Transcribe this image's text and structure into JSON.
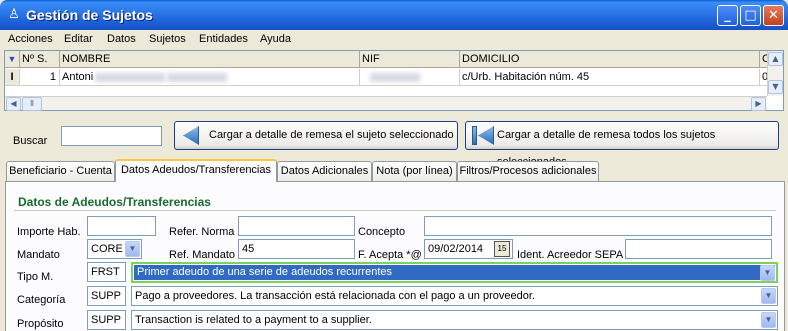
{
  "window": {
    "title": "Gestión de Sujetos",
    "minimize": "_",
    "maximize": "□",
    "close": "✕"
  },
  "menu": [
    "Acciones",
    "Editar",
    "Datos",
    "Sujetos",
    "Entidades",
    "Ayuda"
  ],
  "grid": {
    "columns": [
      "Nº S.",
      "NOMBRE",
      "NIF",
      "DOMICILIO",
      "C"
    ],
    "rows": [
      {
        "num": "1",
        "nombre": "Antoni",
        "nif": "",
        "domicilio": "c/Urb. Habitación núm. 45",
        "c": "0"
      }
    ]
  },
  "search": {
    "label": "Buscar",
    "value": ""
  },
  "actions": {
    "load_selected": "Cargar a detalle de remesa el sujeto seleccionado",
    "load_all": "Cargar a detalle de remesa todos los sujetos seleccionados"
  },
  "tabs": [
    "Beneficiario - Cuenta",
    "Datos Adeudos/Transferencias",
    "Datos Adicionales",
    "Nota (por línea)",
    "Filtros/Procesos adicionales"
  ],
  "active_tab": "Datos Adeudos/Transferencias",
  "section_title": "Datos de Adeudos/Transferencias",
  "form": {
    "importe_hab_label": "Importe Hab.",
    "importe_hab": "",
    "refer_norma_label": "Refer. Norma",
    "refer_norma": "",
    "concepto_label": "Concepto",
    "concepto": "",
    "mandato_label": "Mandato",
    "mandato": "CORE",
    "ref_mandato_label": "Ref. Mandato",
    "ref_mandato": "45",
    "f_acepta_label": "F. Acepta *@",
    "f_acepta": "09/02/2014",
    "ident_acreedor_label": "Ident. Acreedor SEPA",
    "ident_acreedor": "",
    "tipo_m_label": "Tipo M.",
    "tipo_m_code": "FRST",
    "tipo_m_desc": "Primer adeudo de una serie de adeudos recurrentes",
    "categoria_label": "Categoría",
    "categoria_code": "SUPP",
    "categoria_desc": "Pago a proveedores. La transacción está relacionada con el pago a un proveedor.",
    "proposito_label": "Propósito",
    "proposito_code": "SUPP",
    "proposito_desc": "Transaction is related to a payment to a supplier."
  },
  "colors": {
    "titlebar": "#2a74e8",
    "section_title": "#1a6b2e",
    "selection": "#316ac5",
    "focus_border": "#7cd35a"
  }
}
